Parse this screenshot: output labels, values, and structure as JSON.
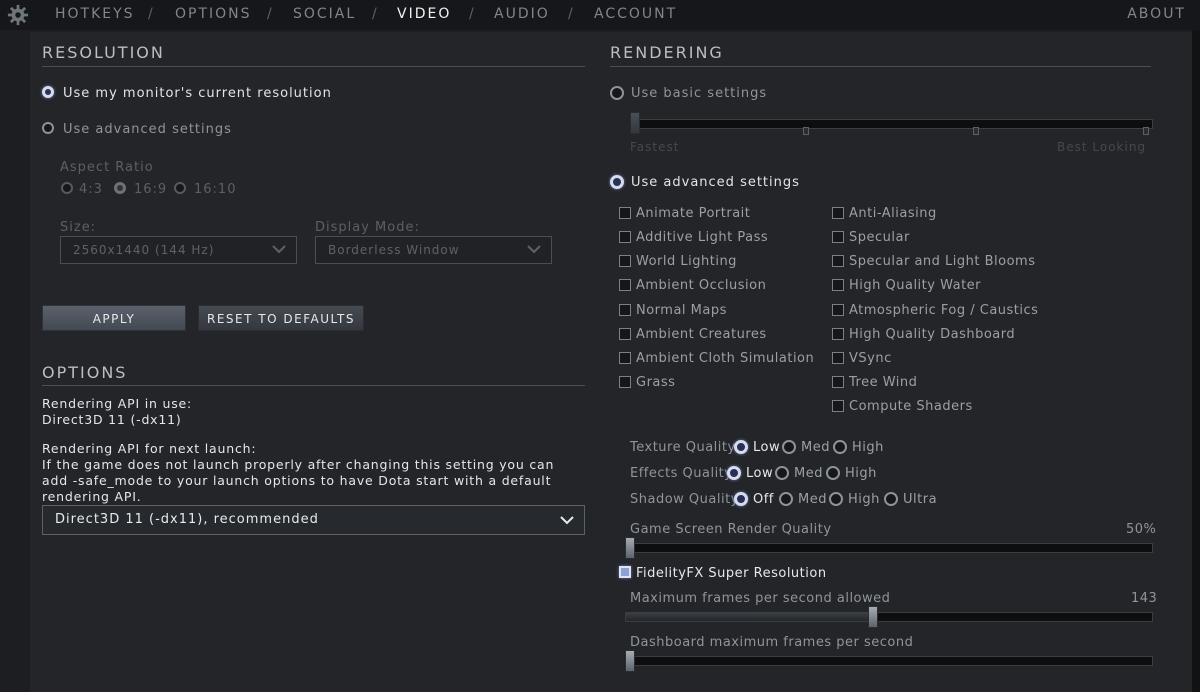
{
  "nav": {
    "tabs": [
      {
        "label": "HOTKEYS"
      },
      {
        "label": "OPTIONS"
      },
      {
        "label": "SOCIAL"
      },
      {
        "label": "VIDEO"
      },
      {
        "label": "AUDIO"
      },
      {
        "label": "ACCOUNT"
      }
    ],
    "separator": "/",
    "about": "ABOUT",
    "active_tab": "VIDEO"
  },
  "resolution": {
    "title": "RESOLUTION",
    "use_monitor": "Use my monitor's current resolution",
    "use_advanced": "Use advanced settings",
    "selected": "use_monitor",
    "aspect_ratio_label": "Aspect Ratio",
    "aspect_options": [
      "4:3",
      "16:9",
      "16:10"
    ],
    "aspect_selected": "16:9",
    "size_label": "Size:",
    "size_value": "2560x1440 (144 Hz)",
    "display_mode_label": "Display Mode:",
    "display_mode_value": "Borderless Window",
    "apply_label": "APPLY",
    "reset_label": "RESET TO DEFAULTS"
  },
  "options": {
    "title": "OPTIONS",
    "api_in_use_label": "Rendering API in use:",
    "api_in_use_value": "Direct3D 11 (-dx11)",
    "api_next_label": "Rendering API for next launch:",
    "api_note_line1": "If the game does not launch properly after changing this setting you can",
    "api_note_line2": "add -safe_mode to your launch options to have Dota start with a default",
    "api_note_line3": "rendering API.",
    "api_select_value": "Direct3D 11 (-dx11), recommended"
  },
  "rendering": {
    "title": "RENDERING",
    "use_basic": "Use basic settings",
    "basic_min_label": "Fastest",
    "basic_max_label": "Best Looking",
    "use_advanced": "Use advanced settings",
    "selected": "use_advanced",
    "left_checks": [
      {
        "label": "Animate Portrait",
        "checked": false
      },
      {
        "label": "Additive Light Pass",
        "checked": false
      },
      {
        "label": "World Lighting",
        "checked": false
      },
      {
        "label": "Ambient Occlusion",
        "checked": false
      },
      {
        "label": "Normal Maps",
        "checked": false
      },
      {
        "label": "Ambient Creatures",
        "checked": false
      },
      {
        "label": "Ambient Cloth Simulation",
        "checked": false
      },
      {
        "label": "Grass",
        "checked": false
      }
    ],
    "right_checks": [
      {
        "label": "Anti-Aliasing",
        "checked": false
      },
      {
        "label": "Specular",
        "checked": false
      },
      {
        "label": "Specular and Light Blooms",
        "checked": false
      },
      {
        "label": "High Quality Water",
        "checked": false
      },
      {
        "label": "Atmospheric Fog / Caustics",
        "checked": false
      },
      {
        "label": "High Quality Dashboard",
        "checked": false
      },
      {
        "label": "VSync",
        "checked": false
      },
      {
        "label": "Tree Wind",
        "checked": false
      },
      {
        "label": "Compute Shaders",
        "checked": false
      }
    ],
    "texture_quality": {
      "label": "Texture Quality",
      "options": [
        "Low",
        "Med",
        "High"
      ],
      "selected": "Low"
    },
    "effects_quality": {
      "label": "Effects Quality",
      "options": [
        "Low",
        "Med",
        "High"
      ],
      "selected": "Low"
    },
    "shadow_quality": {
      "label": "Shadow Quality",
      "options": [
        "Off",
        "Med",
        "High",
        "Ultra"
      ],
      "selected": "Off"
    },
    "render_quality_label": "Game Screen Render Quality",
    "render_quality_value": "50%",
    "fsr_label": "FidelityFX Super Resolution",
    "fsr_checked": true,
    "max_fps_label": "Maximum frames per second allowed",
    "max_fps_value": "143",
    "max_fps_fraction": 0.47,
    "dashboard_fps_label": "Dashboard maximum frames per second"
  }
}
